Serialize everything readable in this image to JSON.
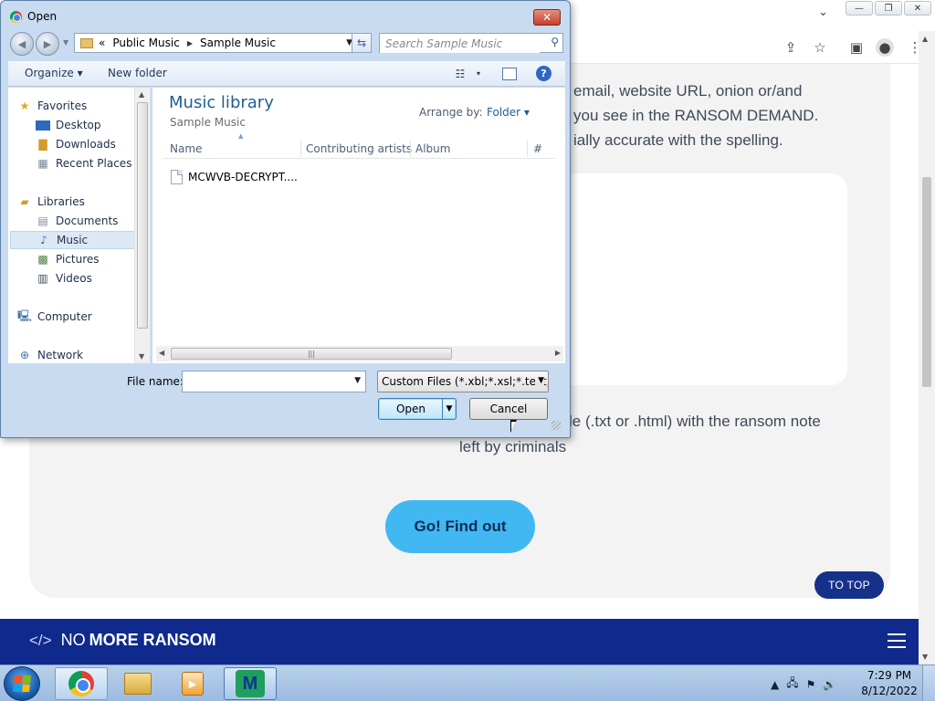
{
  "browser": {
    "site": {
      "instructions": [
        "email, website URL, onion or/and",
        "you see in the RANSOM DEMAND.",
        "ially accurate with the spelling."
      ],
      "upload_text_1": "le (.txt or .html) with the ransom note",
      "upload_text_2": "left by criminals",
      "go_button": "Go! Find out",
      "to_top": "TO TOP",
      "footer": {
        "logo_icon": "</>",
        "logo_a": "NO",
        "logo_b": "MORE RANSOM"
      }
    }
  },
  "dialog": {
    "title": "Open",
    "breadcrumb": [
      "Public Music",
      "Sample Music"
    ],
    "breadcrumb_prefix": "«",
    "search_placeholder": "Search Sample Music",
    "toolbar": {
      "organize": "Organize ▾",
      "new_folder": "New folder"
    },
    "nav_pane": {
      "favorites": "Favorites",
      "desktop": "Desktop",
      "downloads": "Downloads",
      "recent_places": "Recent Places",
      "libraries": "Libraries",
      "documents": "Documents",
      "music": "Music",
      "pictures": "Pictures",
      "videos": "Videos",
      "computer": "Computer",
      "network": "Network"
    },
    "library": {
      "title": "Music library",
      "subtitle": "Sample Music",
      "arrange_label": "Arrange by:",
      "arrange_value": "Folder ▾"
    },
    "columns": {
      "name": "Name",
      "artists": "Contributing artists",
      "album": "Album",
      "number": "#"
    },
    "files": [
      {
        "name": "MCWVB-DECRYPT...."
      }
    ],
    "file_name_label": "File name:",
    "file_name_value": "",
    "filter": "Custom Files (*.xbl;*.xsl;*.text;*.",
    "open_button": "Open",
    "cancel_button": "Cancel"
  },
  "taskbar": {
    "time": "7:29 PM",
    "date": "8/12/2022",
    "apps": [
      "chrome-icon",
      "windows-explorer-icon",
      "media-player-icon",
      "malwarebytes-icon"
    ]
  }
}
